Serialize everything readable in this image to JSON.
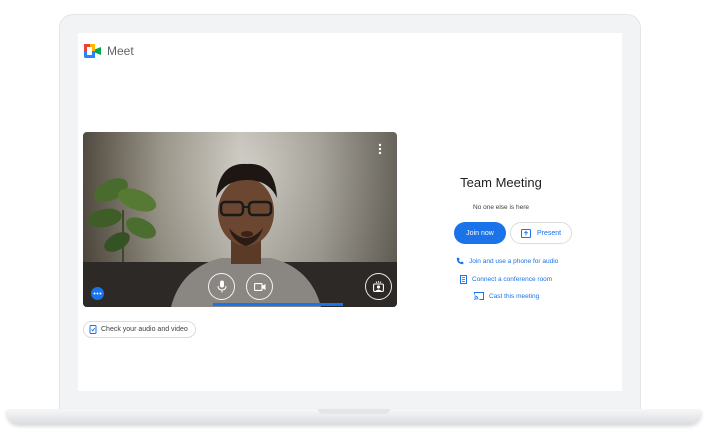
{
  "app": {
    "name": "Meet"
  },
  "preview": {
    "more_options_icon": "more-vert-icon",
    "mic_icon": "mic-icon",
    "camera_icon": "videocam-icon",
    "effects_icon": "visual-effects-icon",
    "dots_icon": "more-horiz-icon",
    "check_audio_label": "Check your audio and video"
  },
  "meeting": {
    "title": "Team Meeting",
    "status": "No one else is here",
    "join_label": "Join now",
    "present_label": "Present",
    "links": [
      {
        "label": "Join and use a phone for audio",
        "icon": "phone-icon"
      },
      {
        "label": "Connect a conference room",
        "icon": "room-icon"
      },
      {
        "label": "Cast this meeting",
        "icon": "cast-icon"
      }
    ]
  },
  "colors": {
    "accent": "#1a73e8",
    "text": "#202124",
    "muted": "#5f6368"
  }
}
